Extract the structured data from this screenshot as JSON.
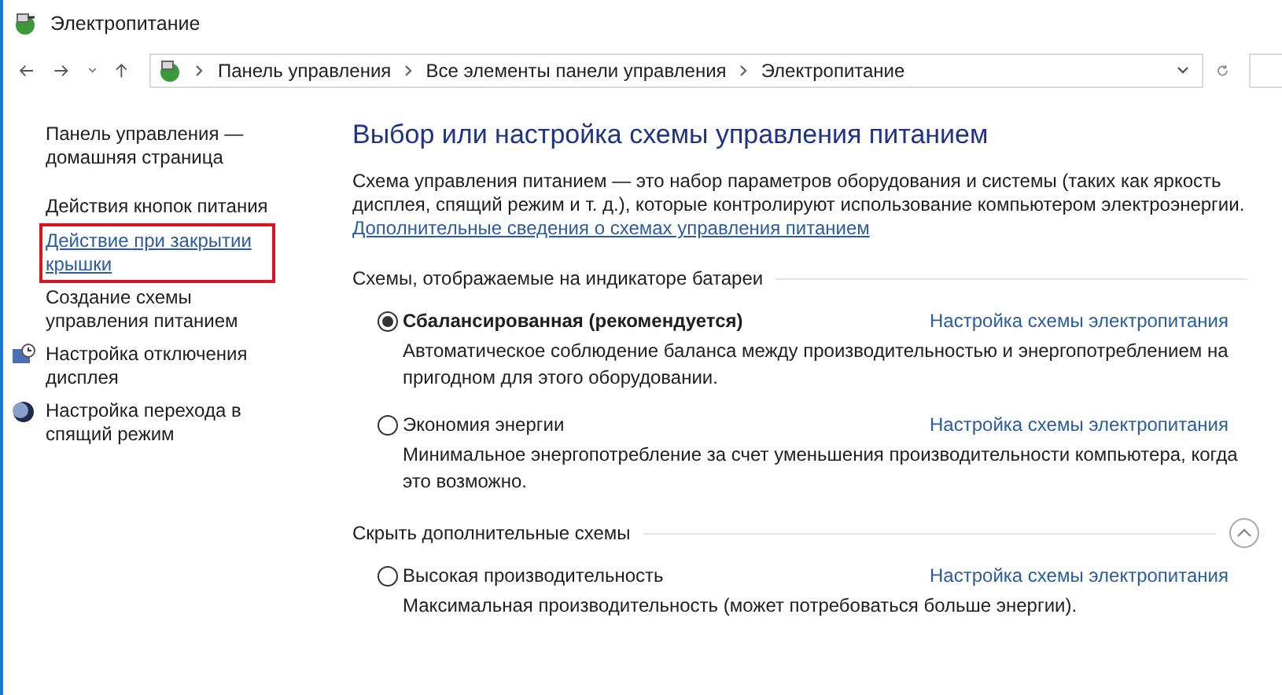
{
  "window": {
    "title": "Электропитание"
  },
  "breadcrumb": [
    "Панель управления",
    "Все элементы панели управления",
    "Электропитание"
  ],
  "sidebar": {
    "items": [
      {
        "label": "Панель управления — домашняя страница",
        "kind": "text",
        "highlighted": false
      },
      {
        "label": "Действия кнопок питания",
        "kind": "text",
        "highlighted": false
      },
      {
        "label": "Действие при закрытии крышки",
        "kind": "text",
        "highlighted": true
      },
      {
        "label": "Создание схемы управления питанием",
        "kind": "text",
        "highlighted": false
      },
      {
        "label": "Настройка отключения дисплея",
        "kind": "display",
        "highlighted": false
      },
      {
        "label": "Настройка перехода в спящий режим",
        "kind": "sleep",
        "highlighted": false
      }
    ]
  },
  "main": {
    "heading": "Выбор или настройка схемы управления питанием",
    "intro": "Схема управления питанием — это набор параметров оборудования и системы (таких как яркость дисплея, спящий режим и т. д.), которые контролируют использование компьютером электроэнергии.",
    "more_link": "Дополнительные сведения о схемах управления питанием",
    "sections": [
      {
        "title": "Схемы, отображаемые на индикаторе батареи",
        "collapse_button": false,
        "plans": [
          {
            "name": "Сбалансированная (рекомендуется)",
            "selected": true,
            "link": "Настройка схемы электропитания",
            "description": "Автоматическое соблюдение баланса между производительностью и энергопотреблением на пригодном для этого оборудовании."
          },
          {
            "name": "Экономия энергии",
            "selected": false,
            "link": "Настройка схемы электропитания",
            "description": "Минимальное энергопотребление за счет уменьшения производительности компьютера, когда это возможно."
          }
        ]
      },
      {
        "title": "Скрыть дополнительные схемы",
        "collapse_button": true,
        "plans": [
          {
            "name": "Высокая производительность",
            "selected": false,
            "link": "Настройка схемы электропитания",
            "description": "Максимальная производительность (может потребоваться больше энергии)."
          }
        ]
      }
    ]
  }
}
